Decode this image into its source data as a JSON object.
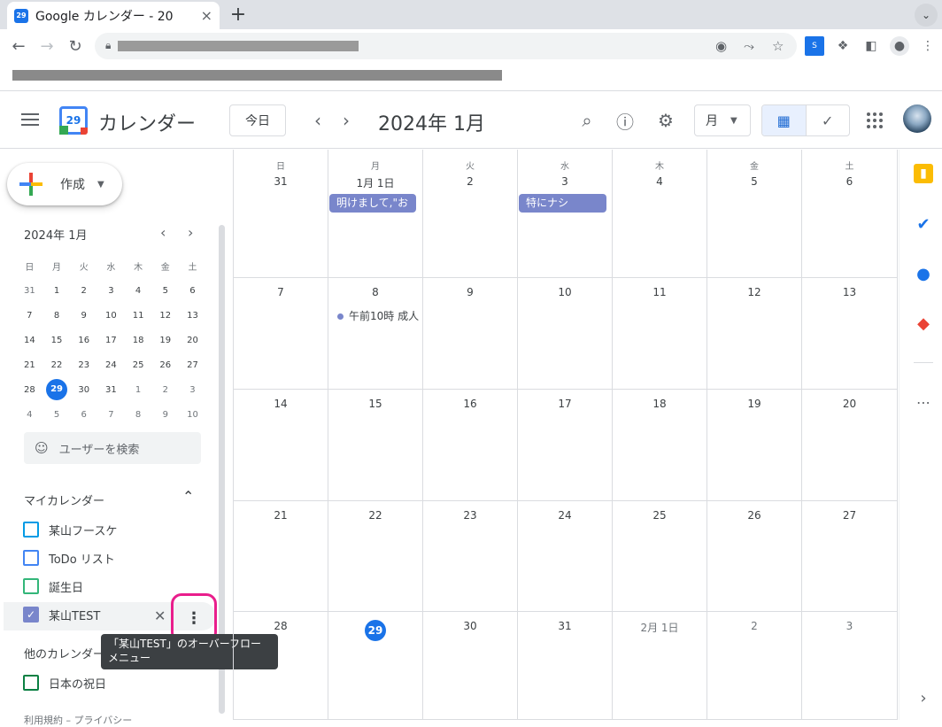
{
  "browser": {
    "tab_title": "Google カレンダー - 20",
    "tab_favicon_text": "29",
    "close_tab": "×",
    "new_tab": "+",
    "tab_menu": "⌄"
  },
  "app": {
    "name": "カレンダー",
    "logo_text": "29",
    "today_button": "今日",
    "month_title": "2024年 1月",
    "view_selector": "月",
    "prev": "‹",
    "next": "›"
  },
  "sidebar": {
    "create_label": "作成",
    "mini_title": "2024年 1月",
    "mini_dows": [
      "日",
      "月",
      "火",
      "水",
      "木",
      "金",
      "土"
    ],
    "mini_weeks": [
      [
        "31",
        "1",
        "2",
        "3",
        "4",
        "5",
        "6"
      ],
      [
        "7",
        "8",
        "9",
        "10",
        "11",
        "12",
        "13"
      ],
      [
        "14",
        "15",
        "16",
        "17",
        "18",
        "19",
        "20"
      ],
      [
        "21",
        "22",
        "23",
        "24",
        "25",
        "26",
        "27"
      ],
      [
        "28",
        "29",
        "30",
        "31",
        "1",
        "2",
        "3"
      ],
      [
        "4",
        "5",
        "6",
        "7",
        "8",
        "9",
        "10"
      ]
    ],
    "mini_today": "29",
    "people_search_placeholder": "ユーザーを検索",
    "my_calendars_header": "マイカレンダー",
    "my_calendars": [
      {
        "label": "某山フースケ",
        "color": "#039be5",
        "checked": false
      },
      {
        "label": "ToDo リスト",
        "color": "#4285f4",
        "checked": false
      },
      {
        "label": "誕生日",
        "color": "#33b679",
        "checked": false
      },
      {
        "label": "某山TEST",
        "color": "#7986cb",
        "checked": true
      }
    ],
    "other_calendars_header": "他のカレンダー",
    "other_calendars": [
      {
        "label": "日本の祝日",
        "color": "#0b8043",
        "checked": false
      }
    ],
    "tooltip": "「某山TEST」のオーバーフローメニュー",
    "footer": "利用規約 – プライバシー"
  },
  "grid": {
    "dows": [
      "日",
      "月",
      "火",
      "水",
      "木",
      "金",
      "土"
    ],
    "weeks": [
      [
        "31",
        "1月 1日",
        "2",
        "3",
        "4",
        "5",
        "6"
      ],
      [
        "7",
        "8",
        "9",
        "10",
        "11",
        "12",
        "13"
      ],
      [
        "14",
        "15",
        "16",
        "17",
        "18",
        "19",
        "20"
      ],
      [
        "21",
        "22",
        "23",
        "24",
        "25",
        "26",
        "27"
      ],
      [
        "28",
        "29",
        "30",
        "31",
        "2月 1日",
        "2",
        "3"
      ]
    ],
    "events": [
      {
        "label": "明けまして,\"お",
        "color": "#7986cb"
      },
      {
        "label": "特にナシ",
        "color": "#7986cb"
      },
      {
        "label": "午前10時 成人",
        "color": "#7986cb"
      }
    ]
  }
}
